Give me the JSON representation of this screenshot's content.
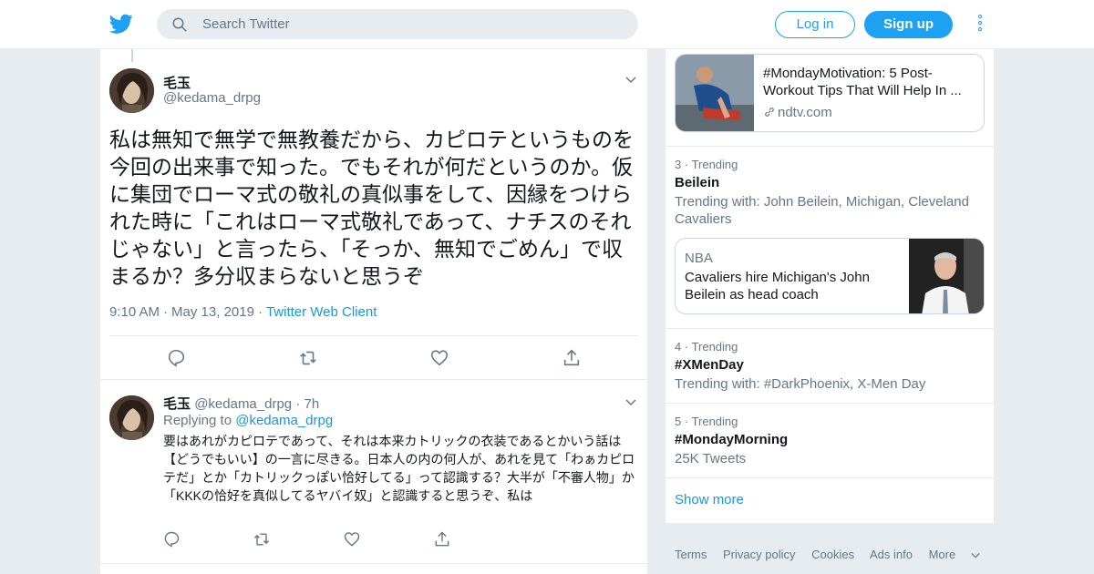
{
  "topbar": {
    "search_placeholder": "Search Twitter",
    "login_label": "Log in",
    "signup_label": "Sign up",
    "brand_color": "#1da1f2"
  },
  "main_tweet": {
    "name": "毛玉",
    "handle": "@kedama_drpg",
    "text": "私は無知で無学で無教養だから、カピロテというものを今回の出来事で知った。でもそれが何だというのか。仮に集団でローマ式の敬礼の真似事をして、因縁をつけられた時に「これはローマ式敬礼であって、ナチスのそれじゃない」と言ったら、「そっか、無知でごめん」で収まるか？多分収まらないと思うぞ",
    "time": "9:10 AM",
    "date": "May 13, 2019",
    "client": "Twitter Web Client"
  },
  "reply_tweet": {
    "name": "毛玉",
    "handle": "@kedama_drpg",
    "age": "7h",
    "replying_label": "Replying to",
    "replying_to": "@kedama_drpg",
    "text": "要はあれがカピロテであって、それは本来カトリックの衣装であるとかいう話は【どうでもいい】の一言に尽きる。日本人の内の何人が、あれを見て「わぁカピロテだ」とか「カトリックっぽい恰好してる」って認識する？大半が「不審人物」か「KKKの恰好を真似してるヤバイ奴」と認識すると思うぞ、私は"
  },
  "sidebar": {
    "card_1": {
      "title": "#MondayMotivation: 5 Post-Workout Tips That Will Help In ...",
      "domain": "ndtv.com"
    },
    "trends": [
      {
        "rank": "3",
        "label": "Trending",
        "name": "Beilein",
        "sub": "Trending with: John Beilein, Michigan, Cleveland Cavaliers"
      },
      {
        "rank": "4",
        "label": "Trending",
        "name": "#XMenDay",
        "sub": "Trending with: #DarkPhoenix, X-Men Day"
      },
      {
        "rank": "5",
        "label": "Trending",
        "name": "#MondayMorning",
        "sub": "25K Tweets"
      }
    ],
    "card_2": {
      "source": "NBA",
      "body": "Cavaliers hire Michigan's John Beilein as head coach"
    },
    "show_more": "Show more"
  },
  "footer": {
    "links": [
      "Terms",
      "Privacy policy",
      "Cookies",
      "Ads info",
      "More"
    ]
  }
}
